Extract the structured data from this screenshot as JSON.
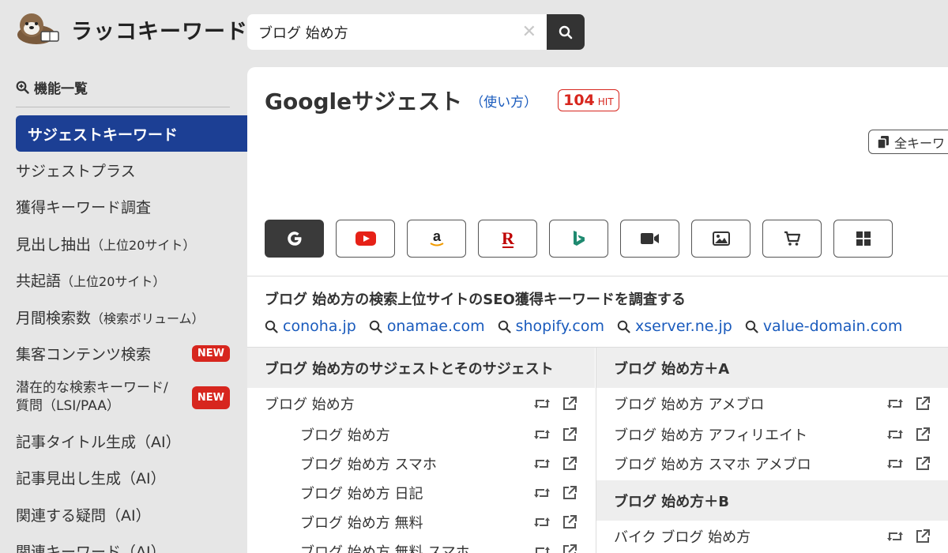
{
  "header": {
    "logo_text": "ラッコキーワード",
    "search_value": "ブログ 始め方",
    "clear_icon": "close-icon",
    "search_icon": "search-icon"
  },
  "sidebar": {
    "heading": "機能一覧",
    "items": [
      {
        "label": "サジェストキーワード"
      },
      {
        "label": "サジェストプラス"
      },
      {
        "label": "獲得キーワード調査"
      },
      {
        "label": "見出し抽出",
        "note": "（上位20サイト）"
      },
      {
        "label": "共起語",
        "note": "（上位20サイト）"
      },
      {
        "label": "月間検索数",
        "note": "（検索ボリューム）"
      },
      {
        "label": "集客コンテンツ検索",
        "badge": "NEW"
      },
      {
        "label": "潜在的な検索キーワード/",
        "label2": "質問（LSI/PAA）",
        "badge": "NEW"
      },
      {
        "label": "記事タイトル生成（AI）"
      },
      {
        "label": "記事見出し生成（AI）"
      },
      {
        "label": "関連する疑問（AI）"
      },
      {
        "label": "関連キーワード（AI）"
      }
    ]
  },
  "main": {
    "title": "Googleサジェスト",
    "howto": "（使い方）",
    "hit_count": "104",
    "hit_unit": "HIT",
    "copy_label": "全キーワ",
    "engines": [
      "google-icon",
      "youtube-icon",
      "amazon-icon",
      "rakuten-icon",
      "bing-icon",
      "video-icon",
      "image-icon",
      "shopping-icon",
      "windows-icon"
    ],
    "seo_title": "ブログ 始め方の検索上位サイトのSEO獲得キーワードを調査する",
    "sites": [
      "conoha.jp",
      "onamae.com",
      "shopify.com",
      "xserver.ne.jp",
      "value-domain.com"
    ],
    "left_column": {
      "heading": "ブログ 始め方のサジェストとそのサジェスト",
      "rows": [
        "ブログ 始め方",
        "ブログ 始め方",
        "ブログ 始め方 スマホ",
        "ブログ 始め方 日記",
        "ブログ 始め方 無料",
        "ブログ 始め方 無料 スマホ"
      ]
    },
    "right_column": {
      "heading_a": "ブログ 始め方＋A",
      "rows_a": [
        "ブログ 始め方 アメブロ",
        "ブログ 始め方 アフィリエイト",
        "ブログ 始め方 スマホ アメブロ"
      ],
      "heading_b": "ブログ 始め方＋B",
      "rows_b": [
        "バイク ブログ 始め方"
      ]
    }
  }
}
